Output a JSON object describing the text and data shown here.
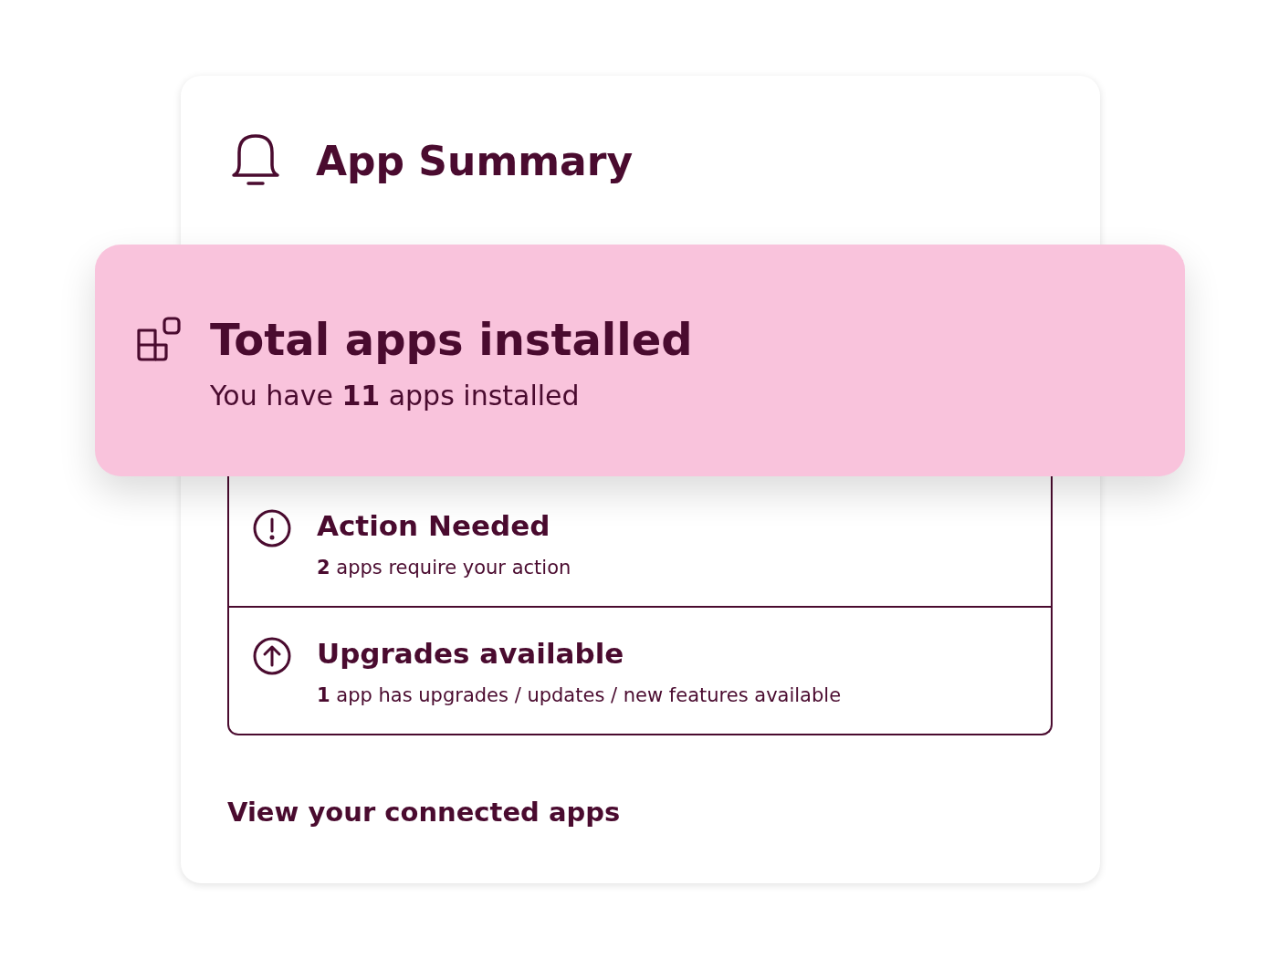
{
  "card": {
    "title": "App Summary"
  },
  "total": {
    "title": "Total apps installed",
    "text": "You have **11** apps installed"
  },
  "items": [
    {
      "kind": "alert",
      "title": "Action Needed",
      "text": "**2** apps require your action"
    },
    {
      "kind": "upgrade",
      "title": "Upgrades available",
      "text": "**1** app has upgrades / updates / new features available"
    }
  ],
  "link": "View your connected apps"
}
